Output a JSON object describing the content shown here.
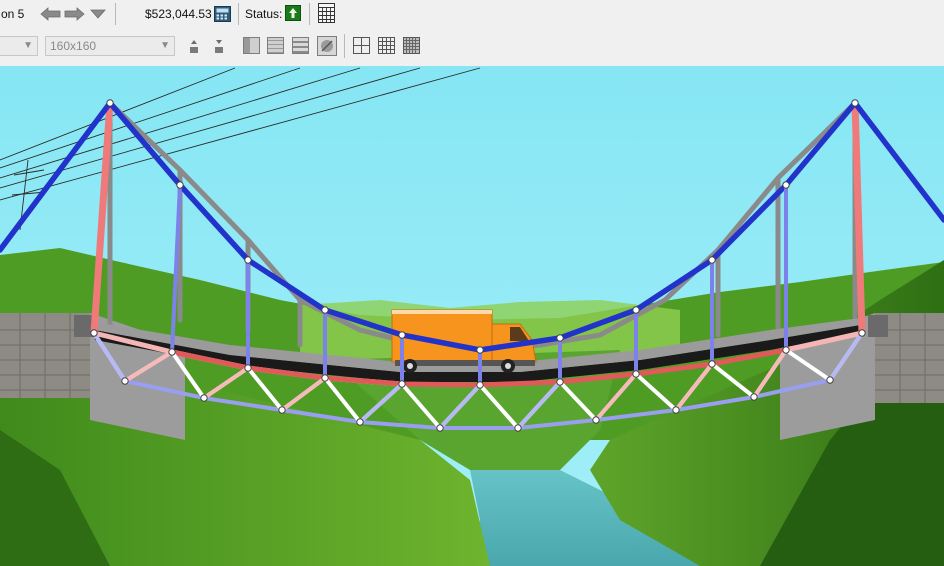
{
  "toolbar": {
    "iteration_label": "on 5",
    "budget": "$523,044.53",
    "status_label": "Status:",
    "tile_size": "160x160",
    "icons": {
      "back": "arrow-left-icon",
      "forward": "arrow-right-icon",
      "dropdown": "triangle-down-icon",
      "calculator": "calculator-icon",
      "status": "tree-up-icon",
      "report": "report-icon",
      "member_up": "member-up-icon",
      "member_down": "member-down-icon",
      "grid_coarse": "grid-coarse-icon",
      "grid_medium": "grid-medium-icon",
      "grid_fine": "grid-fine-icon"
    }
  },
  "colors": {
    "sky": "#8ee9f5",
    "compression": "#e05a5a",
    "tension": "#1f2fd6",
    "truck_body": "#f7941d",
    "grass": "#4e9a22",
    "water": "#5fb8b8"
  }
}
